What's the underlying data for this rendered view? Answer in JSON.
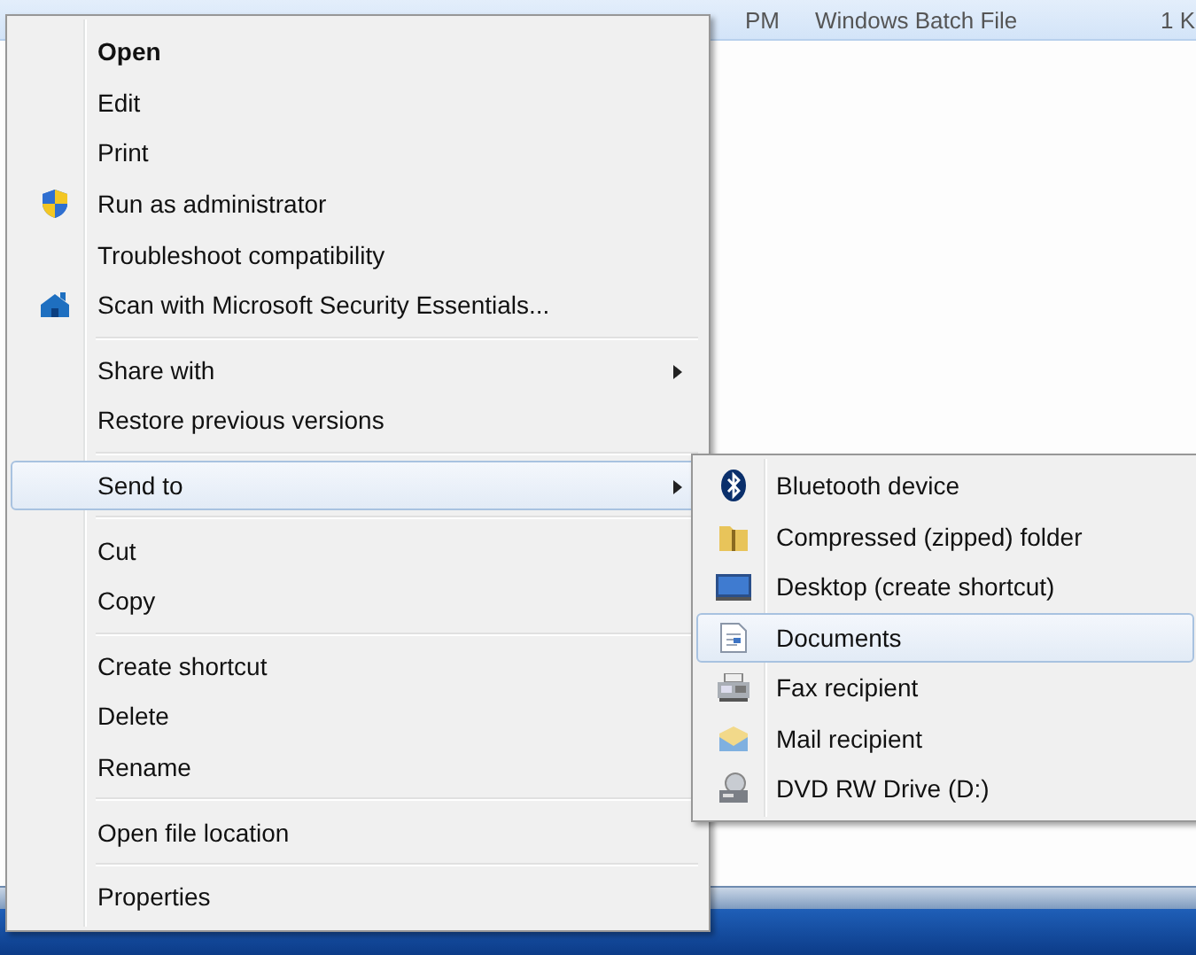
{
  "file_row": {
    "modified": "PM",
    "type": "Windows Batch File",
    "size": "1 K"
  },
  "context_menu": {
    "groups": [
      [
        {
          "label": "Open",
          "bold": true,
          "kind": "plain",
          "submenu": false,
          "selected": false
        },
        {
          "label": "Edit",
          "bold": false,
          "kind": "plain",
          "submenu": false,
          "selected": false
        },
        {
          "label": "Print",
          "bold": false,
          "kind": "plain",
          "submenu": false,
          "selected": false
        },
        {
          "label": "Run as administrator",
          "bold": false,
          "kind": "shield",
          "submenu": false,
          "selected": false
        },
        {
          "label": "Troubleshoot compatibility",
          "bold": false,
          "kind": "plain",
          "submenu": false,
          "selected": false
        },
        {
          "label": "Scan with Microsoft Security Essentials...",
          "bold": false,
          "kind": "house",
          "submenu": false,
          "selected": false
        }
      ],
      [
        {
          "label": "Share with",
          "bold": false,
          "kind": "plain",
          "submenu": true,
          "selected": false
        },
        {
          "label": "Restore previous versions",
          "bold": false,
          "kind": "plain",
          "submenu": false,
          "selected": false
        }
      ],
      [
        {
          "label": "Send to",
          "bold": false,
          "kind": "plain",
          "submenu": true,
          "selected": true
        }
      ],
      [
        {
          "label": "Cut",
          "bold": false,
          "kind": "plain",
          "submenu": false,
          "selected": false
        },
        {
          "label": "Copy",
          "bold": false,
          "kind": "plain",
          "submenu": false,
          "selected": false
        }
      ],
      [
        {
          "label": "Create shortcut",
          "bold": false,
          "kind": "plain",
          "submenu": false,
          "selected": false
        },
        {
          "label": "Delete",
          "bold": false,
          "kind": "plain",
          "submenu": false,
          "selected": false
        },
        {
          "label": "Rename",
          "bold": false,
          "kind": "plain",
          "submenu": false,
          "selected": false
        }
      ],
      [
        {
          "label": "Open file location",
          "bold": false,
          "kind": "plain",
          "submenu": false,
          "selected": false
        }
      ],
      [
        {
          "label": "Properties",
          "bold": false,
          "kind": "plain",
          "submenu": false,
          "selected": false
        }
      ]
    ]
  },
  "send_to_menu": {
    "items": [
      {
        "label": "Bluetooth device",
        "kind": "bluetooth",
        "selected": false
      },
      {
        "label": "Compressed (zipped) folder",
        "kind": "zip",
        "selected": false
      },
      {
        "label": "Desktop (create shortcut)",
        "kind": "monitor",
        "selected": false
      },
      {
        "label": "Documents",
        "kind": "document",
        "selected": true
      },
      {
        "label": "Fax recipient",
        "kind": "fax",
        "selected": false
      },
      {
        "label": "Mail recipient",
        "kind": "mail",
        "selected": false
      },
      {
        "label": "DVD RW Drive (D:)",
        "kind": "drive",
        "selected": false
      }
    ]
  }
}
